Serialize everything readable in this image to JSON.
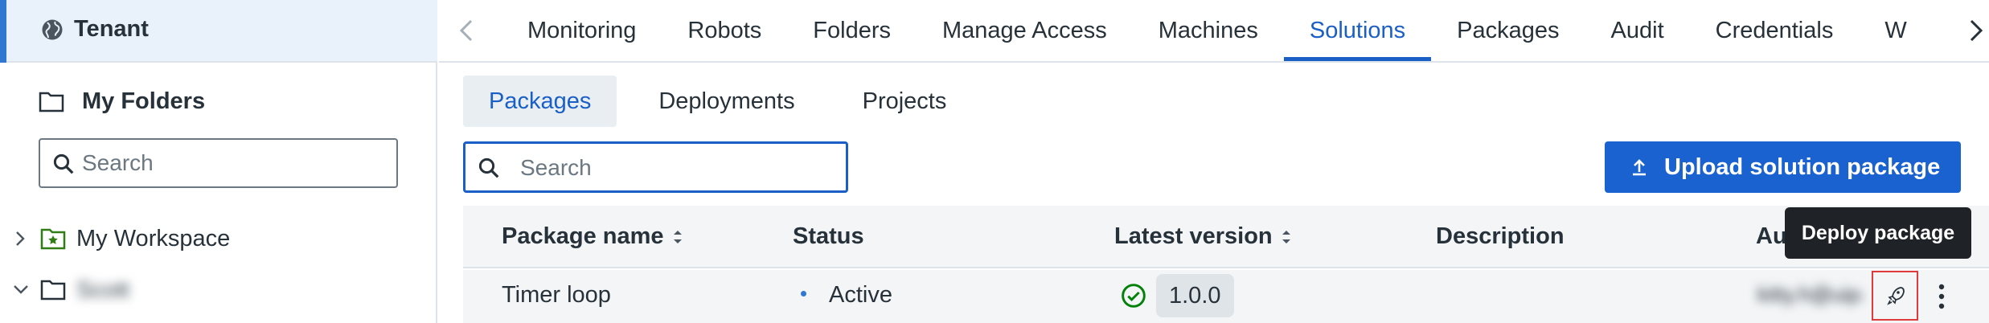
{
  "sidebar": {
    "tenant_label": "Tenant",
    "my_folders_label": "My Folders",
    "search_placeholder": "Search",
    "tree": [
      {
        "label": "My Workspace",
        "expanded": false
      },
      {
        "label": "Scott",
        "expanded": true
      }
    ]
  },
  "topnav": {
    "tabs": [
      "Monitoring",
      "Robots",
      "Folders",
      "Manage Access",
      "Machines",
      "Solutions",
      "Packages",
      "Audit",
      "Credentials",
      "W"
    ],
    "active_tab": "Solutions"
  },
  "subtabs": {
    "items": [
      "Packages",
      "Deployments",
      "Projects"
    ],
    "active": "Packages"
  },
  "package_search": {
    "placeholder": "Search"
  },
  "upload_button": {
    "label": "Upload solution package"
  },
  "table": {
    "headers": {
      "name": "Package name",
      "status": "Status",
      "version": "Latest version",
      "description": "Description",
      "author": "Au"
    },
    "rows": [
      {
        "name": "Timer loop",
        "status": "Active",
        "version": "1.0.0",
        "description": "",
        "author": "kitty.h@uipath.com"
      }
    ]
  },
  "tooltip": {
    "text": "Deploy package"
  },
  "colors": {
    "accent": "#1a5fc6",
    "success": "#038108",
    "highlight": "#e23a3a"
  }
}
